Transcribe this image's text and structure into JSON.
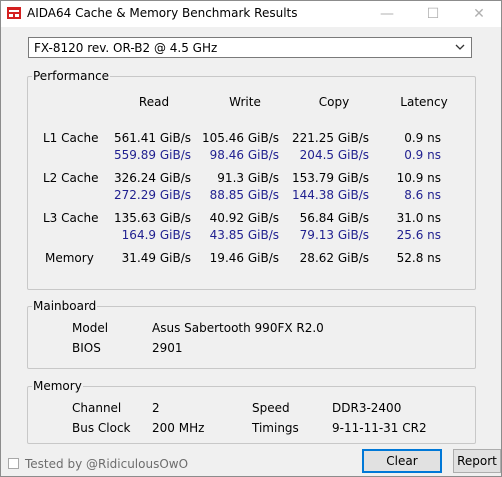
{
  "window": {
    "title": "AIDA64 Cache & Memory Benchmark Results",
    "minimize_glyph": "—",
    "maximize_glyph": "☐",
    "close_glyph": "✕"
  },
  "cpu_select": {
    "value": "FX-8120 rev. OR-B2 @ 4.5 GHz"
  },
  "performance": {
    "title": "Performance",
    "headers": [
      "Read",
      "Write",
      "Copy",
      "Latency"
    ],
    "rows": [
      {
        "label": "L1 Cache",
        "primary": [
          "561.41 GiB/s",
          "105.46 GiB/s",
          "221.25 GiB/s",
          "0.9 ns"
        ],
        "secondary": [
          "559.89 GiB/s",
          "98.46 GiB/s",
          "204.5 GiB/s",
          "0.9 ns"
        ]
      },
      {
        "label": "L2 Cache",
        "primary": [
          "326.24 GiB/s",
          "91.3 GiB/s",
          "153.79 GiB/s",
          "10.9 ns"
        ],
        "secondary": [
          "272.29 GiB/s",
          "88.85 GiB/s",
          "144.38 GiB/s",
          "8.6 ns"
        ]
      },
      {
        "label": "L3 Cache",
        "primary": [
          "135.63 GiB/s",
          "40.92 GiB/s",
          "56.84 GiB/s",
          "31.0 ns"
        ],
        "secondary": [
          "164.9 GiB/s",
          "43.85 GiB/s",
          "79.13 GiB/s",
          "25.6 ns"
        ]
      },
      {
        "label": "Memory",
        "primary": [
          "31.49 GiB/s",
          "19.46 GiB/s",
          "28.62 GiB/s",
          "52.8 ns"
        ]
      }
    ]
  },
  "mainboard": {
    "title": "Mainboard",
    "model_label": "Model",
    "model_value": "Asus Sabertooth 990FX R2.0",
    "bios_label": "BIOS",
    "bios_value": "2901"
  },
  "memory": {
    "title": "Memory",
    "channel_label": "Channel",
    "channel_value": "2",
    "speed_label": "Speed",
    "speed_value": "DDR3-2400",
    "busclock_label": "Bus Clock",
    "busclock_value": "200 MHz",
    "timings_label": "Timings",
    "timings_value": "9-11-11-31 CR2"
  },
  "footer": {
    "checkbox_label": "Tested by @RidiculousOwO",
    "clear_label": "Clear",
    "report_label": "Report"
  }
}
